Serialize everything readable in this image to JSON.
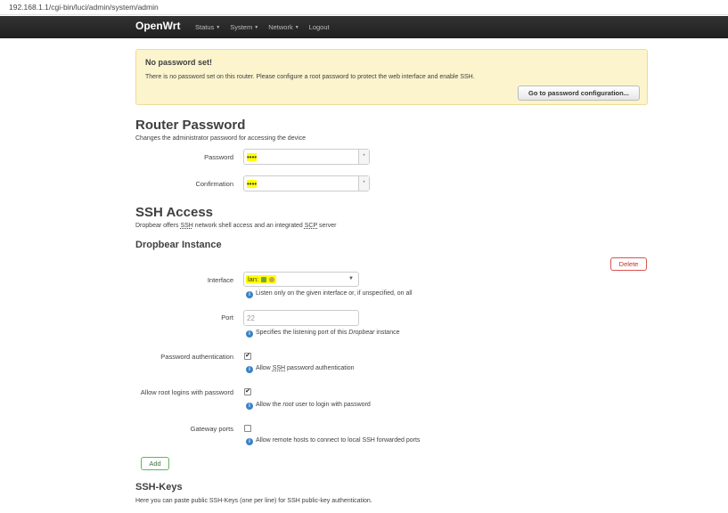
{
  "browser": {
    "url": "192.168.1.1/cgi-bin/luci/admin/system/admin"
  },
  "navbar": {
    "brand": "OpenWrt",
    "items": [
      {
        "label": "Status",
        "dropdown": true
      },
      {
        "label": "System",
        "dropdown": true
      },
      {
        "label": "Network",
        "dropdown": true
      },
      {
        "label": "Logout",
        "dropdown": false
      }
    ]
  },
  "alert": {
    "title": "No password set!",
    "text": "There is no password set on this router. Please configure a root password to protect the web interface and enable SSH.",
    "button": "Go to password configuration..."
  },
  "router_password": {
    "title": "Router Password",
    "description": "Changes the administrator password for accessing the device",
    "password_label": "Password",
    "password_value": "••••",
    "confirmation_label": "Confirmation",
    "confirmation_value": "••••",
    "reveal_icon": "*"
  },
  "ssh": {
    "title": "SSH Access",
    "description_pre": "Dropbear offers ",
    "description_ssh": "SSH",
    "description_mid": " network shell access and an integrated ",
    "description_scp": "SCP",
    "description_post": " server",
    "instance_title": "Dropbear Instance",
    "delete_label": "Delete",
    "interface_label": "Interface",
    "interface_value": "lan:",
    "interface_help": "Listen only on the given interface or, if unspecified, on all",
    "port_label": "Port",
    "port_placeholder": "22",
    "port_help_pre": "Specifies the listening port of this ",
    "port_help_em": "Dropbear",
    "port_help_post": " instance",
    "pwauth_label": "Password authentication",
    "pwauth_checked": true,
    "pwauth_help_pre": "Allow ",
    "pwauth_help_abbr": "SSH",
    "pwauth_help_post": " password authentication",
    "root_label": "Allow root logins with password",
    "root_checked": true,
    "root_help_pre": "Allow the ",
    "root_help_em": "root",
    "root_help_post": " user to login with password",
    "gw_label": "Gateway ports",
    "gw_checked": false,
    "gw_help": "Allow remote hosts to connect to local SSH forwarded ports",
    "add_label": "Add",
    "check_mark": "✔"
  },
  "ssh_keys": {
    "title": "SSH-Keys",
    "description": "Here you can paste public SSH-Keys (one per line) for SSH public-key authentication."
  },
  "colors": {
    "navbar": "#222222",
    "alert_bg": "#fcf4cd",
    "highlight": "#ffff00",
    "help_icon": "#3a83c6",
    "delete": "#d9534f",
    "add": "#5cb85c"
  }
}
